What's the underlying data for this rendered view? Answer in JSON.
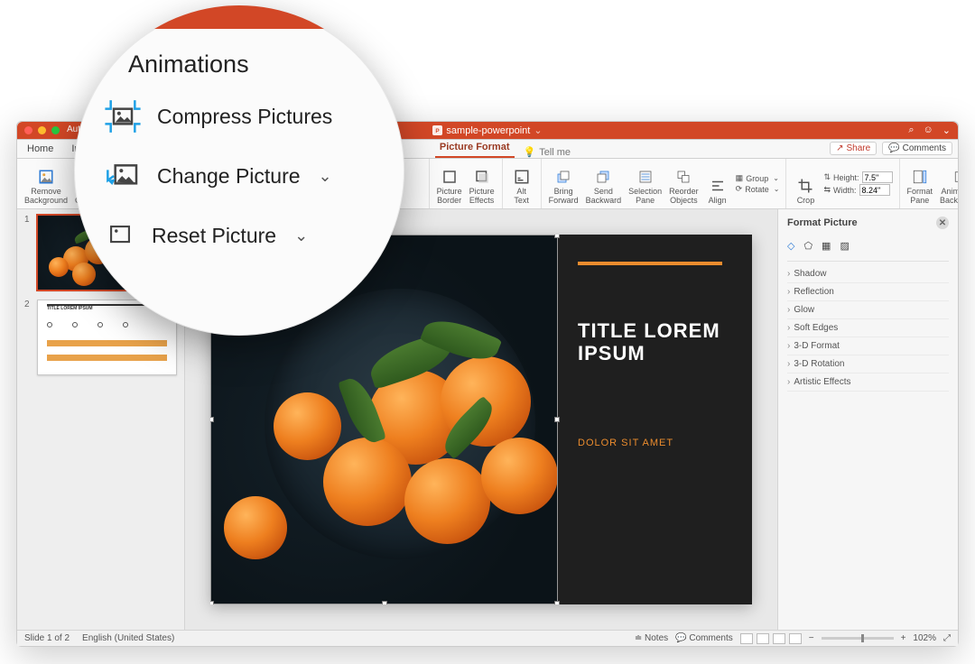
{
  "title": "sample-powerpoint",
  "autosave": "AutoSave",
  "tabs": {
    "home": "Home",
    "insert": "Insert",
    "pictureformat": "Picture Format",
    "tellme": "Tell me"
  },
  "actions": {
    "share": "Share",
    "comments": "Comments"
  },
  "ribbon": {
    "removebg": "Remove\nBackground",
    "compress": "Compress Pictures",
    "changepic": "Change Picture",
    "resetpic": "Reset Picture",
    "picborder": "Picture\nBorder",
    "piceffects": "Picture\nEffects",
    "alttext": "Alt\nText",
    "bringfwd": "Bring\nForward",
    "sendback": "Send\nBackward",
    "selpane": "Selection\nPane",
    "reorder": "Reorder\nObjects",
    "align": "Align",
    "group": "Group",
    "rotate": "Rotate",
    "crop": "Crop",
    "heightlabel": "Height:",
    "heightval": "7.5\"",
    "widthlabel": "Width:",
    "widthval": "8.24\"",
    "formatpane": "Format\nPane",
    "animatebg": "Animate as\nBackground"
  },
  "slide": {
    "title": "TITLE LOREM IPSUM",
    "subtitle": "DOLOR SIT AMET"
  },
  "thumb2": {
    "title": "TITLE LOREM IPSUM"
  },
  "sidepanel": {
    "title": "Format Picture",
    "rows": [
      "Shadow",
      "Reflection",
      "Glow",
      "Soft Edges",
      "3-D Format",
      "3-D Rotation",
      "Artistic Effects"
    ]
  },
  "status": {
    "left": "Slide 1 of 2",
    "lang": "English (United States)",
    "notes": "Notes",
    "comments": "Comments",
    "zoom": "102%"
  },
  "magnifier": {
    "heading": "Animations",
    "compress": "Compress Pictures",
    "change": "Change Picture",
    "reset": "Reset Picture"
  }
}
